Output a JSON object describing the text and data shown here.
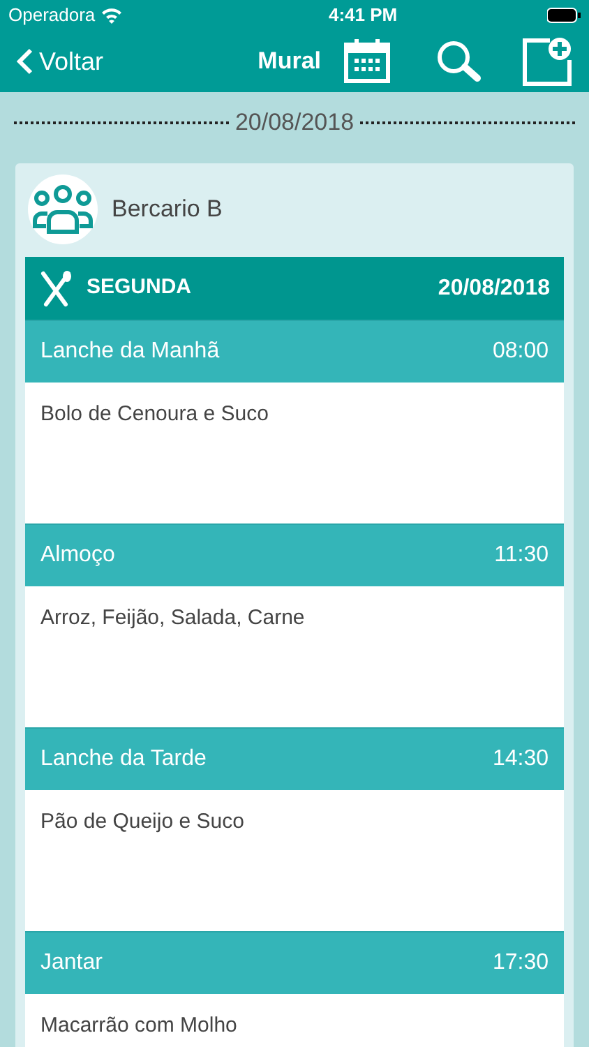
{
  "status_bar": {
    "carrier": "Operadora",
    "time": "4:41 PM"
  },
  "nav": {
    "back": "Voltar",
    "title": "Mural"
  },
  "date_divider": "20/08/2018",
  "card": {
    "group": "Bercario B",
    "day": "SEGUNDA",
    "date": "20/08/2018",
    "meals": [
      {
        "name": "Lanche da Manhã",
        "time": "08:00",
        "menu": "Bolo de Cenoura e Suco"
      },
      {
        "name": "Almoço",
        "time": "11:30",
        "menu": "Arroz, Feijão, Salada, Carne"
      },
      {
        "name": "Lanche da Tarde",
        "time": "14:30",
        "menu": "Pão de Queijo e Suco"
      },
      {
        "name": "Jantar",
        "time": "17:30",
        "menu": "Macarrão com Molho"
      }
    ]
  }
}
